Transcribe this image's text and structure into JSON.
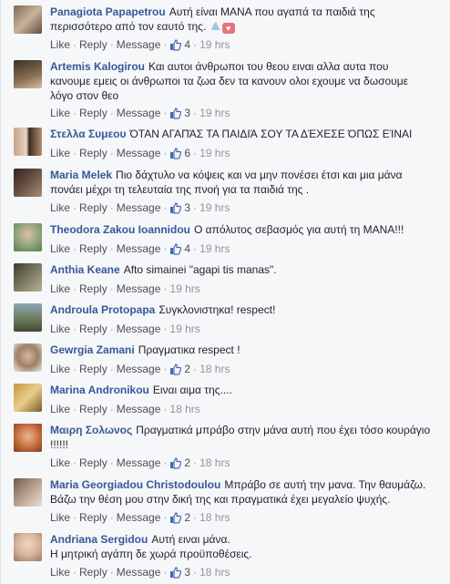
{
  "actions": {
    "like": "Like",
    "reply": "Reply",
    "message": "Message"
  },
  "colors": {
    "name_link": "#365899",
    "meta": "#90949c",
    "like_icon": "#4267b2"
  },
  "comments": [
    {
      "name": "Panagiota Papapetrou",
      "text_line1": "Αυτή είναι ΜΑΝΑ που αγαπά τα παιδιά της",
      "text_line2": "περισσότερο από τον εαυτό της.",
      "likes": "4",
      "time": "19 hrs"
    },
    {
      "name": "Artemis Kalogirou",
      "text_line1": "Και αυτοι άνθρωποι του θεου ειναι αλλα αυτα που",
      "text_line2": "κανουμε εμεις οι άνθρωποι τα ζωα δεν τα κανουν ολοι εχουμε να δωσουμε",
      "text_line3": "λόγο στον θεο",
      "likes": "3",
      "time": "19 hrs"
    },
    {
      "name": "Στελλα Συμεου",
      "text_line1": "ΌΤΑΝ ΑΓΑΠΆΣ ΤΑ ΠΑΙΔΙΆ ΣΟΥ ΤΑ ΔΈΧΕΣΕ ΌΠΩΣ ΕΊΝΑΙ",
      "likes": "6",
      "time": "19 hrs"
    },
    {
      "name": "Maria Melek",
      "text_line1": "Πιο δάχτυλο να κόψεις και να μην πονέσει έτσι και μια μάνα",
      "text_line2": "πονάει μέχρι τη τελευταία της πνοή για τα παιδιά της .",
      "likes": "3",
      "time": "19 hrs"
    },
    {
      "name": "Theodora Zakou Ioannidou",
      "text_line1": "Ο απόλυτος σεβασμός για αυτή τη ΜΑΝΑ!!!",
      "likes": "4",
      "time": "19 hrs"
    },
    {
      "name": "Anthia Keane",
      "text_line1": "Afto simainei \"agapi tis manas\".",
      "time": "19 hrs"
    },
    {
      "name": "Androula Protopapa",
      "text_line1": "Συγκλονιστηκα! respect!",
      "time": "19 hrs"
    },
    {
      "name": "Gewrgia Zamani",
      "text_line1": "Πραγματικα respect !",
      "likes": "2",
      "time": "18 hrs"
    },
    {
      "name": "Marina Andronikou",
      "text_line1": "Ειναι αιμα της....",
      "time": "18 hrs"
    },
    {
      "name": "Μαιρη Σολωνος",
      "text_line1": "Πραγματικά μπράβο στην μάνα αυτή που έχει τόσο κουράγιο",
      "text_line2": "!!!!!!",
      "likes": "2",
      "time": "18 hrs"
    },
    {
      "name": "Maria Georgiadou Christodoulou",
      "text_line1": "Μπράβο σε αυτή την μανα. Την θαυμάζω.",
      "text_line2": "Βάζω την θέση μου στην δική της και πραγματικά έχει μεγαλείο ψυχής.",
      "likes": "2",
      "time": "18 hrs"
    },
    {
      "name": "Andriana Sergidou",
      "text_line1": "Αυτή ειναι μάνα.",
      "text_line2": "Η μητρική αγάπη δε χωρά προϋποθέσεις.",
      "likes": "3",
      "time": "18 hrs"
    }
  ]
}
